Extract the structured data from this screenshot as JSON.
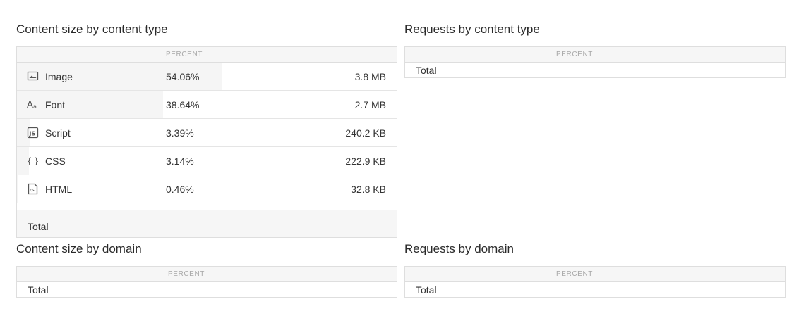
{
  "panels": {
    "content_size_type": {
      "title": "Content size by content type",
      "percent_header": "PERCENT",
      "rows": [
        {
          "name": "Image",
          "percent": "54.06%",
          "share": 0.5406,
          "size": "3.8 MB",
          "icon": "image-icon"
        },
        {
          "name": "Font",
          "percent": "38.64%",
          "share": 0.3864,
          "size": "2.7 MB",
          "icon": "font-icon"
        },
        {
          "name": "Script",
          "percent": "3.39%",
          "share": 0.0339,
          "size": "240.2 KB",
          "icon": "script-icon"
        },
        {
          "name": "CSS",
          "percent": "3.14%",
          "share": 0.0314,
          "size": "222.9 KB",
          "icon": "css-icon"
        },
        {
          "name": "HTML",
          "percent": "0.46%",
          "share": 0.0046,
          "size": "32.8 KB",
          "icon": "html-icon"
        }
      ],
      "total_label": "Total"
    },
    "requests_type": {
      "title": "Requests by content type",
      "percent_header": "PERCENT",
      "total_label": "Total"
    },
    "content_size_domain": {
      "title": "Content size by domain",
      "percent_header": "PERCENT",
      "total_label": "Total"
    },
    "requests_domain": {
      "title": "Requests by domain",
      "percent_header": "PERCENT",
      "total_label": "Total"
    }
  }
}
